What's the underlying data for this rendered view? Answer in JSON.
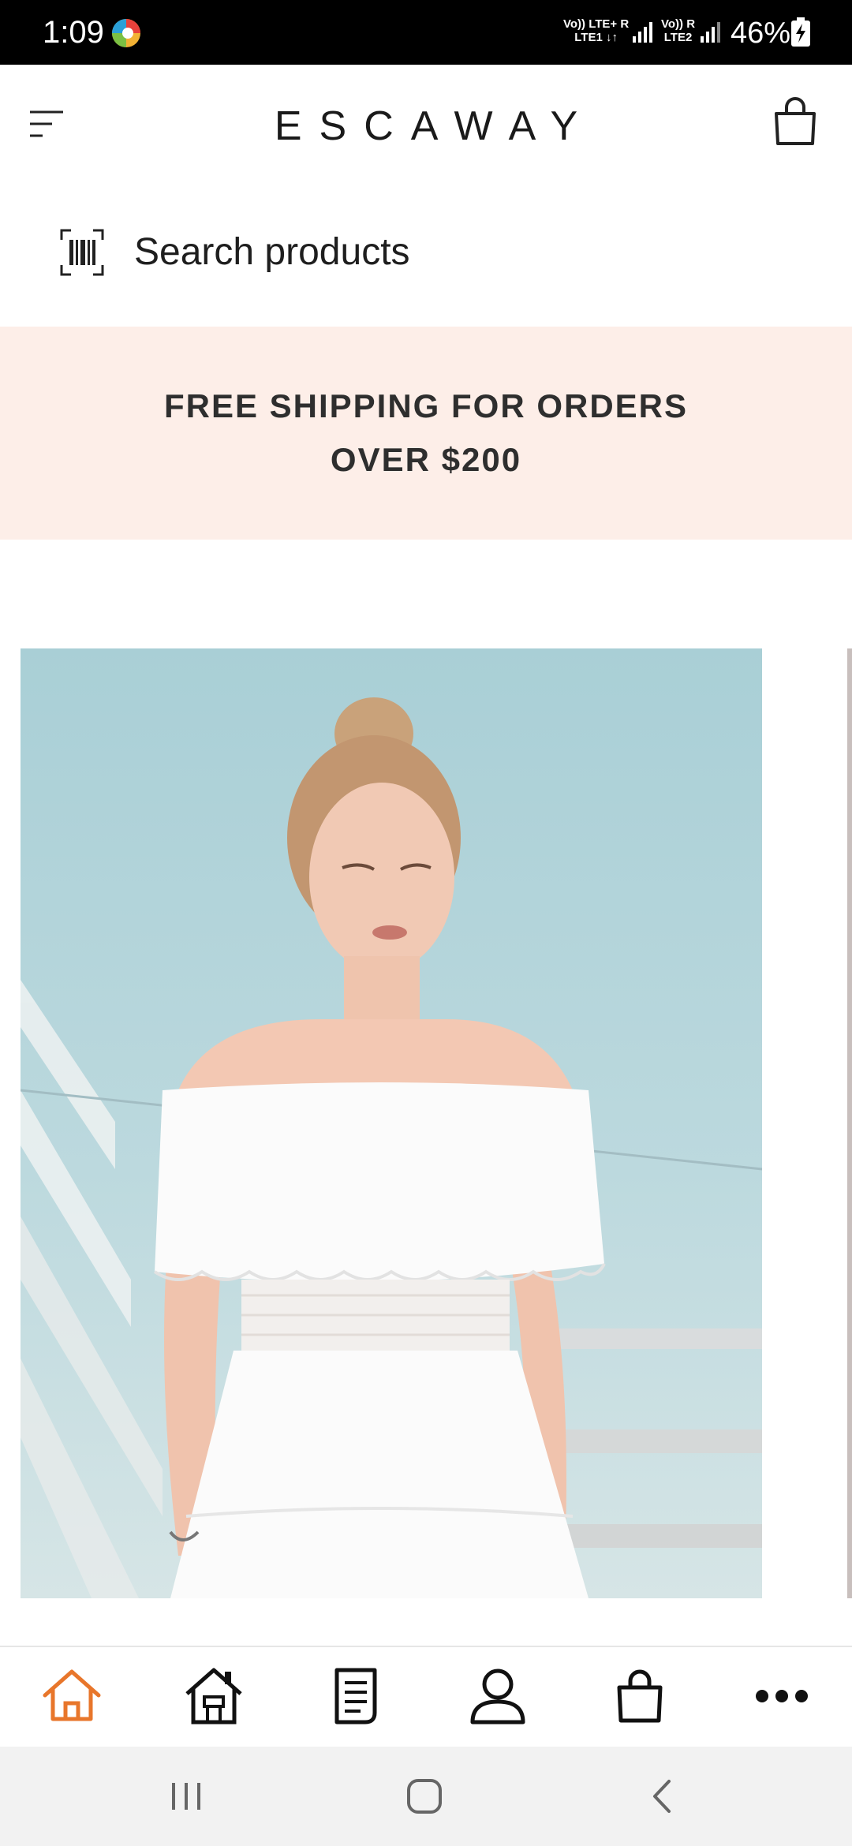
{
  "status_bar": {
    "time": "1:09",
    "sim1_top": "Vo)) LTE+ R",
    "sim1_bottom": "LTE1 ↓↑",
    "sim2_top": "Vo)) R",
    "sim2_bottom": "LTE2",
    "battery": "46%"
  },
  "header": {
    "brand": "ESCAWAY",
    "menu_icon": "menu-icon",
    "cart_icon": "shopping-bag-icon"
  },
  "search": {
    "placeholder": "Search products",
    "icon": "barcode-scan-icon"
  },
  "promo": {
    "text": "FREE SHIPPING FOR ORDERS OVER $200"
  },
  "bottom_nav": {
    "active_color": "#e8762b",
    "items": [
      {
        "icon": "home-outline-icon",
        "active": true
      },
      {
        "icon": "store-icon",
        "active": false
      },
      {
        "icon": "document-icon",
        "active": false
      },
      {
        "icon": "user-icon",
        "active": false
      },
      {
        "icon": "shopping-bag-icon",
        "active": false
      },
      {
        "icon": "more-icon",
        "active": false
      }
    ]
  },
  "system_nav": {
    "items": [
      {
        "icon": "recents-icon"
      },
      {
        "icon": "home-icon"
      },
      {
        "icon": "back-icon"
      }
    ]
  }
}
